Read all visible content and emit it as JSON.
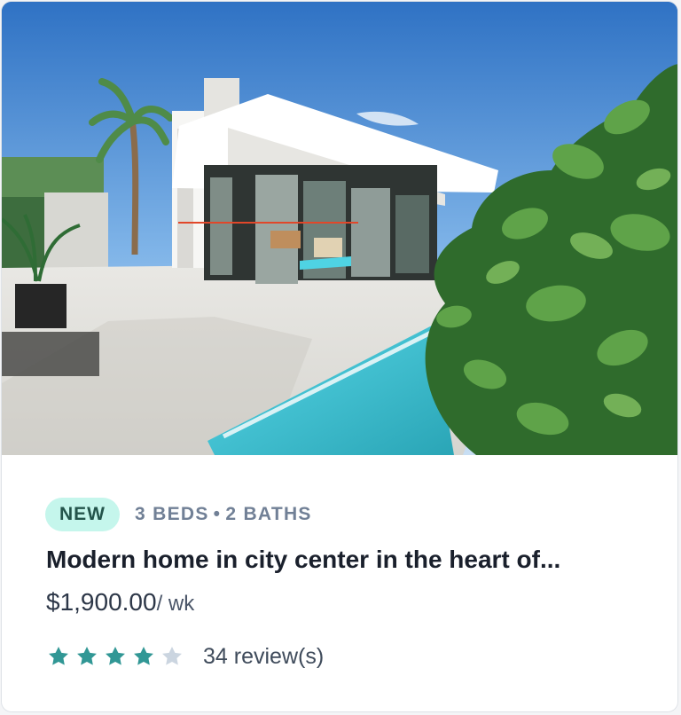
{
  "listing": {
    "photo_alt": "Modern white house with glass walls, pool and large green plant",
    "badge": "NEW",
    "beds": "3 BEDS",
    "separator": "•",
    "baths": "2 BATHS",
    "title": "Modern home in city center in the heart of...",
    "price": "$1,900.00",
    "period": "/ wk",
    "rating": {
      "value": 4,
      "max": 5,
      "filled_color": "#319795",
      "empty_color": "#cbd5e0"
    },
    "reviews_label": "34 review(s)",
    "underline_color": "#e1472a"
  },
  "icons": {
    "star": "star-icon"
  }
}
